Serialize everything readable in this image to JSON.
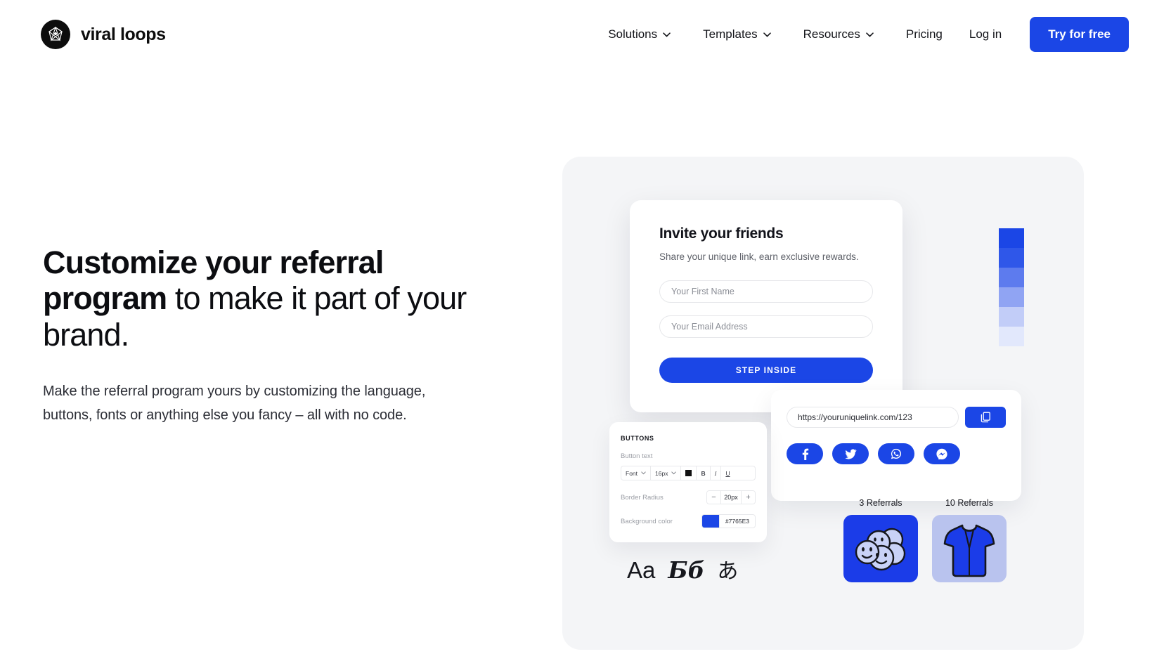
{
  "brand": {
    "name": "viral loops",
    "logo_icon": "polyhedron-gem-icon",
    "logo_bg": "#0d0d0d"
  },
  "nav": {
    "items": [
      {
        "label": "Solutions",
        "icon": "chevron-down-icon"
      },
      {
        "label": "Templates",
        "icon": "chevron-down-icon"
      },
      {
        "label": "Resources",
        "icon": "chevron-down-icon"
      },
      {
        "label": "Pricing",
        "icon": ""
      }
    ],
    "login_label": "Log in",
    "cta_label": "Try for free",
    "cta_color": "#1b46e6"
  },
  "hero": {
    "heading_bold": "Customize your referral program",
    "heading_rest": " to make it part of your brand.",
    "paragraph": "Make the referral program yours by customizing the language, buttons, fonts or anything else you fancy – all with no code."
  },
  "mockup": {
    "panel_bg": "#f4f5f7",
    "bars": [
      "#1b46e6",
      "#2f57e9",
      "#5d7bee",
      "#90a4f3",
      "#c2cdf8",
      "#e2e8fc"
    ],
    "invite": {
      "title": "Invite your friends",
      "subtitle": "Share your unique link, earn exclusive rewards.",
      "first_name_placeholder": "Your First Name",
      "email_placeholder": "Your Email Address",
      "button_label": "STEP INSIDE"
    },
    "share": {
      "url": "https://youruniquelink.com/123",
      "copy_icon": "copy-icon",
      "socials": [
        {
          "name": "facebook-icon"
        },
        {
          "name": "twitter-icon"
        },
        {
          "name": "whatsapp-icon"
        },
        {
          "name": "messenger-icon"
        }
      ]
    },
    "settings": {
      "header": "BUTTONS",
      "button_text_label": "Button text",
      "font_label": "Font",
      "size_label": "16px",
      "text_color": "#111111",
      "bold_label": "B",
      "italic_label": "I",
      "underline_label": "U",
      "border_radius_label": "Border Radius",
      "border_radius_value": "20px",
      "minus_label": "−",
      "plus_label": "+",
      "background_color_label": "Background color",
      "background_color_hex": "#7765E3",
      "background_color_swatch": "#1b46e6"
    },
    "typography": {
      "latin": "Aa",
      "cyrillic": "Бб",
      "japanese": "あ"
    },
    "rewards": [
      {
        "caption": "3 Referrals",
        "icon": "smiley-stickers-icon",
        "tile_color": "#1b3ce8"
      },
      {
        "caption": "10 Referrals",
        "icon": "hoodie-icon",
        "tile_color": "#b9c3ee"
      }
    ]
  }
}
